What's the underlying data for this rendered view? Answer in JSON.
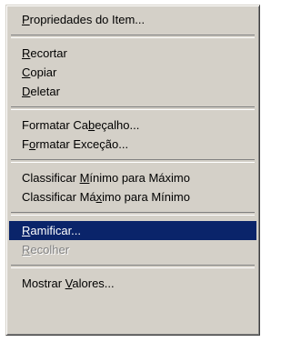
{
  "menu": {
    "items": [
      {
        "type": "item",
        "pre": "",
        "mn": "P",
        "post": "ropriedades do Item...",
        "state": "normal"
      },
      {
        "type": "separator"
      },
      {
        "type": "item",
        "pre": "",
        "mn": "R",
        "post": "ecortar",
        "state": "normal"
      },
      {
        "type": "item",
        "pre": "",
        "mn": "C",
        "post": "opiar",
        "state": "normal"
      },
      {
        "type": "item",
        "pre": "",
        "mn": "D",
        "post": "eletar",
        "state": "normal"
      },
      {
        "type": "separator"
      },
      {
        "type": "item",
        "pre": "Formatar Ca",
        "mn": "b",
        "post": "eçalho...",
        "state": "normal"
      },
      {
        "type": "item",
        "pre": "F",
        "mn": "o",
        "post": "rmatar Exceção...",
        "state": "normal"
      },
      {
        "type": "separator"
      },
      {
        "type": "item",
        "pre": "Classificar ",
        "mn": "M",
        "post": "ínimo para Máximo",
        "state": "normal"
      },
      {
        "type": "item",
        "pre": "Classificar Má",
        "mn": "x",
        "post": "imo para Mínimo",
        "state": "normal"
      },
      {
        "type": "separator"
      },
      {
        "type": "item",
        "pre": "",
        "mn": "R",
        "post": "amificar...",
        "state": "selected"
      },
      {
        "type": "item",
        "pre": "",
        "mn": "R",
        "post": "ecolher",
        "state": "disabled"
      },
      {
        "type": "separator"
      },
      {
        "type": "item",
        "pre": "Mostrar ",
        "mn": "V",
        "post": "alores...",
        "state": "normal"
      }
    ]
  }
}
